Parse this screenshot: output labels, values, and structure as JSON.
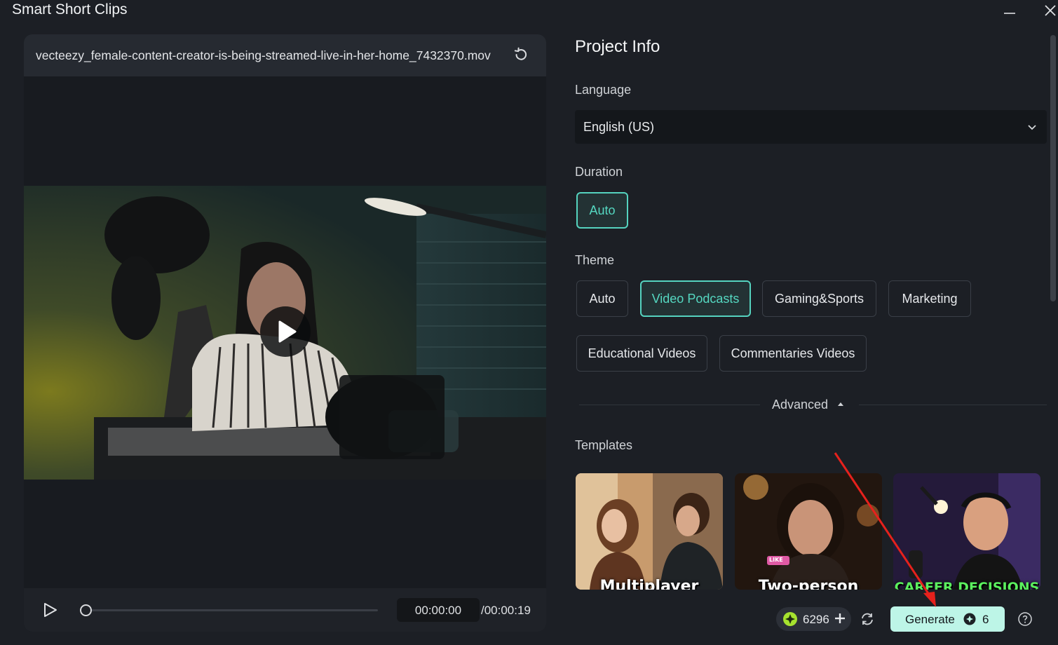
{
  "window": {
    "title": "Smart Short Clips"
  },
  "preview": {
    "file_name": "vecteezy_female-content-creator-is-being-streamed-live-in-her-home_7432370.mov",
    "current_time": "00:00:00",
    "total_time": "/00:00:19",
    "progress": 0
  },
  "project": {
    "title": "Project Info",
    "language_label": "Language",
    "language_value": "English (US)",
    "duration_label": "Duration",
    "duration_option": "Auto",
    "theme_label": "Theme",
    "themes": [
      "Auto",
      "Video Podcasts",
      "Gaming&Sports",
      "Marketing",
      "Educational Videos",
      "Commentaries Videos"
    ],
    "selected_theme": "Video Podcasts",
    "advanced_label": "Advanced",
    "templates_label": "Templates",
    "templates": [
      {
        "label": "Multiplayer"
      },
      {
        "label": "Two-person",
        "badge": "LIKE"
      },
      {
        "label": "CAREER DECISIONS"
      }
    ]
  },
  "footer": {
    "credits": "6296",
    "generate_label": "Generate",
    "generate_cost": "6"
  },
  "colors": {
    "accent": "#55d3bf",
    "generate_bg": "#bdf5e7",
    "background": "#1c1f25"
  }
}
